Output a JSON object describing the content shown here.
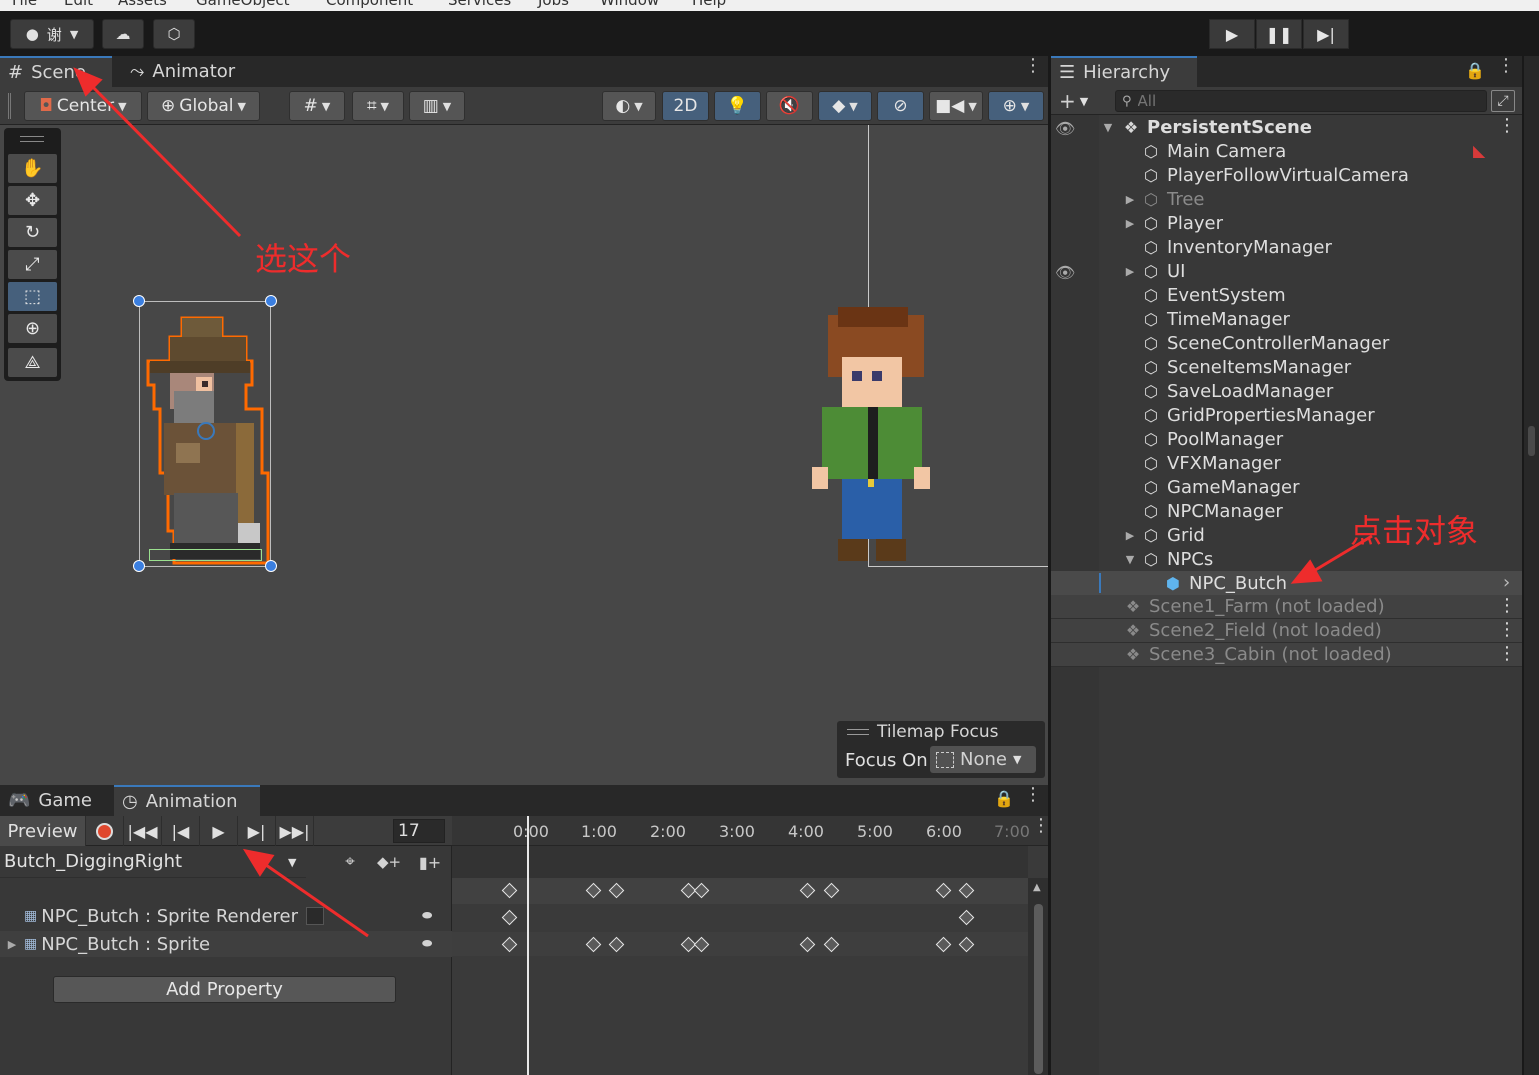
{
  "menu": {
    "items": [
      "File",
      "Edit",
      "Assets",
      "GameObject",
      "Component",
      "Services",
      "Jobs",
      "Window",
      "Help"
    ]
  },
  "toolbar": {
    "account_label": "谢"
  },
  "scene_panel": {
    "tabs": [
      {
        "label": "Scene"
      },
      {
        "label": "Animator"
      }
    ],
    "tools": {
      "pivot_label": "Center",
      "space_label": "Global",
      "mode_2d_label": "2D"
    }
  },
  "tilemap_focus": {
    "title": "Tilemap Focus",
    "focus_label": "Focus On",
    "focus_value": "None"
  },
  "anim_panel": {
    "tabs": [
      {
        "label": "Game"
      },
      {
        "label": "Animation"
      }
    ],
    "preview_label": "Preview",
    "frame_value": "17",
    "clip_name": "Butch_DiggingRight",
    "properties": [
      "NPC_Butch : Sprite Renderer",
      "NPC_Butch : Sprite"
    ],
    "add_property_label": "Add Property",
    "ruler_labels": [
      "0:00",
      "1:00",
      "2:00",
      "3:00",
      "4:00",
      "5:00",
      "6:00",
      "7:00"
    ]
  },
  "hierarchy": {
    "tab_label": "Hierarchy",
    "search_placeholder": "All",
    "root_scene": "PersistentScene",
    "items": [
      {
        "name": "Main Camera"
      },
      {
        "name": "PlayerFollowVirtualCamera"
      },
      {
        "name": "Tree"
      },
      {
        "name": "Player"
      },
      {
        "name": "InventoryManager"
      },
      {
        "name": "UI"
      },
      {
        "name": "EventSystem"
      },
      {
        "name": "TimeManager"
      },
      {
        "name": "SceneControllerManager"
      },
      {
        "name": "SceneItemsManager"
      },
      {
        "name": "SaveLoadManager"
      },
      {
        "name": "GridPropertiesManager"
      },
      {
        "name": "PoolManager"
      },
      {
        "name": "VFXManager"
      },
      {
        "name": "GameManager"
      },
      {
        "name": "NPCManager"
      },
      {
        "name": "Grid"
      },
      {
        "name": "NPCs"
      },
      {
        "name": "NPC_Butch"
      }
    ],
    "other_scenes": [
      "Scene1_Farm (not loaded)",
      "Scene2_Field (not loaded)",
      "Scene3_Cabin (not loaded)"
    ]
  },
  "annotations": {
    "select_this": "选这个",
    "click_object": "点击对象"
  },
  "colors": {
    "accent": "#3a79bb",
    "annotation": "#ee2c2c",
    "selection_blue": "#46607c"
  }
}
